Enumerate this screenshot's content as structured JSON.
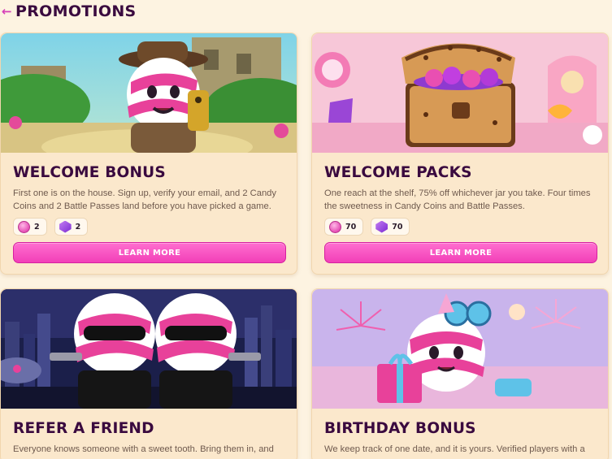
{
  "header": {
    "title": "PROMOTIONS",
    "back_icon": "arrow-left-icon"
  },
  "colors": {
    "accent": "#f23fb8",
    "title": "#3a0a3f",
    "background": "#fdf3e1",
    "card": "#fbe8cc"
  },
  "cards": [
    {
      "title": "WELCOME BONUS",
      "description": "First one is on the house. Sign up, verify your email, and 2 Candy Coins and 2 Battle Passes land before you have picked a game.",
      "rewards": [
        {
          "icon": "candy-coin-icon",
          "value": "2"
        },
        {
          "icon": "battle-pass-icon",
          "value": "2"
        }
      ],
      "button": "LEARN MORE"
    },
    {
      "title": "WELCOME PACKS",
      "description": "One reach at the shelf, 75% off whichever jar you take. Four times the sweetness in Candy Coins and Battle Passes.",
      "rewards": [
        {
          "icon": "candy-coin-icon",
          "value": "70"
        },
        {
          "icon": "battle-pass-icon",
          "value": "70"
        }
      ],
      "button": "LEARN MORE"
    },
    {
      "title": "REFER A FRIEND",
      "description": "Everyone knows someone with a sweet tooth. Bring them in, and every"
    },
    {
      "title": "BIRTHDAY BONUS",
      "description": "We keep track of one date, and it is yours. Verified players with a"
    }
  ]
}
